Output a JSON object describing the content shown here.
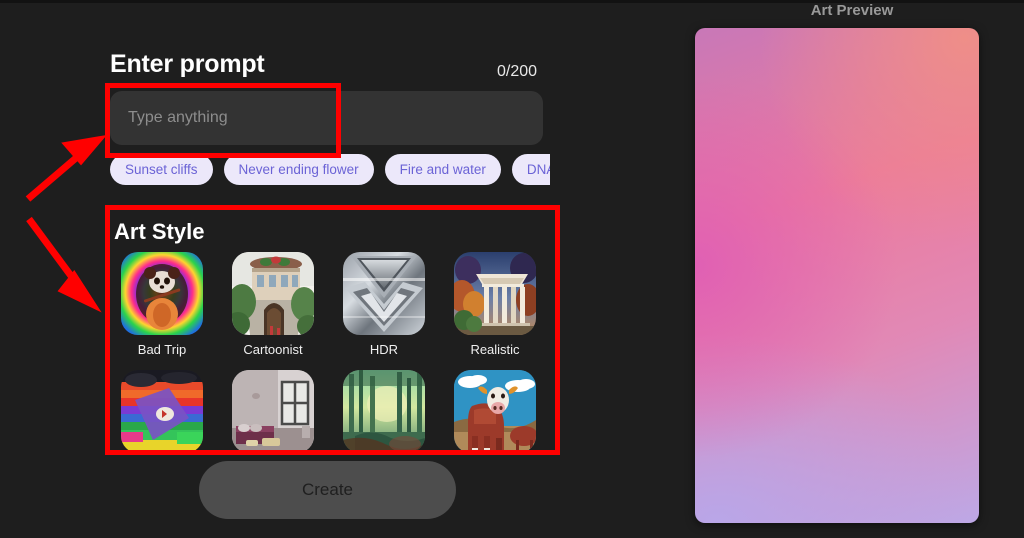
{
  "app": {
    "background_color": "#1e1e1e",
    "accent_color": "#6b63d6",
    "annotation_color": "#ff0000"
  },
  "prompt_section": {
    "title": "Enter prompt",
    "char_counter": "0/200",
    "input_value": "",
    "input_placeholder": "Type anything",
    "suggestions": [
      {
        "label": "Sunset cliffs"
      },
      {
        "label": "Never ending flower"
      },
      {
        "label": "Fire and water"
      },
      {
        "label": "DNA tornado"
      }
    ]
  },
  "art_style_section": {
    "title": "Art Style",
    "styles": [
      {
        "label": "Bad Trip",
        "icon": "psychedelic-red-panda-thumbnail"
      },
      {
        "label": "Cartoonist",
        "icon": "cartoon-building-thumbnail"
      },
      {
        "label": "HDR",
        "icon": "metallic-chrome-thumbnail"
      },
      {
        "label": "Realistic",
        "icon": "classical-temple-thumbnail"
      },
      {
        "label": "",
        "icon": "abstract-rainbow-thumbnail"
      },
      {
        "label": "",
        "icon": "interior-room-thumbnail"
      },
      {
        "label": "",
        "icon": "green-forest-thumbnail"
      },
      {
        "label": "",
        "icon": "cow-landscape-thumbnail"
      }
    ]
  },
  "actions": {
    "create_label": "Create"
  },
  "preview_section": {
    "title": "Art Preview",
    "gradient_colors": [
      "#ef8e88",
      "#ec7a9c",
      "#e060b4",
      "#bda8e6"
    ]
  }
}
